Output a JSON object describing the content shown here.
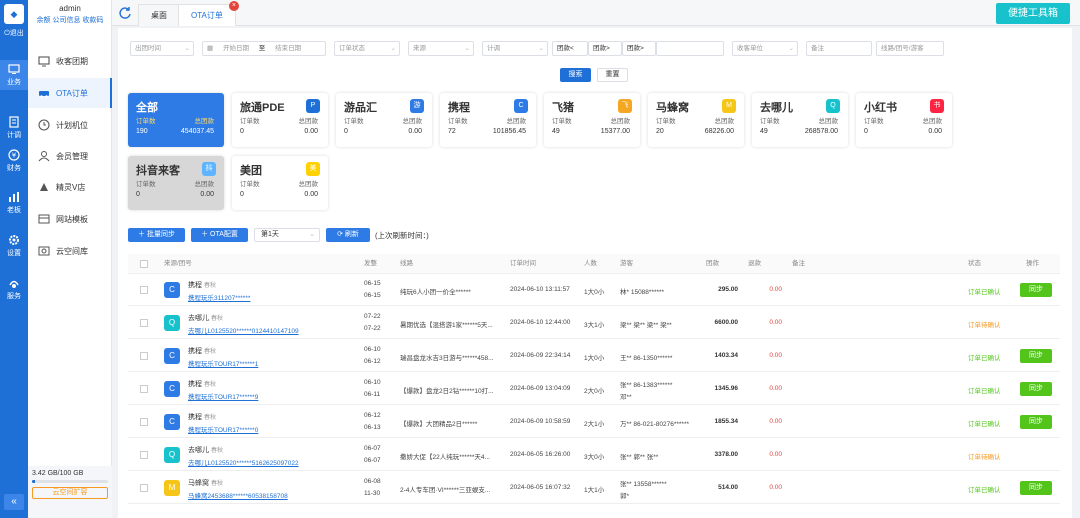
{
  "user": {
    "name": "admin",
    "links": "余额 公司信息 收款码"
  },
  "iconbar": {
    "logout": "退出",
    "items": [
      {
        "label": "业务",
        "icon": "business-icon",
        "active": true
      },
      {
        "label": "计调",
        "icon": "schedule-icon",
        "active": false
      },
      {
        "label": "财务",
        "icon": "finance-icon",
        "active": false
      },
      {
        "label": "老板",
        "icon": "chart-icon",
        "active": false
      },
      {
        "label": "设置",
        "icon": "gear-icon",
        "active": false
      },
      {
        "label": "服务",
        "icon": "service-icon",
        "active": false
      }
    ]
  },
  "menu": {
    "items": [
      {
        "label": "收客团期",
        "icon": "monitor-icon"
      },
      {
        "label": "OTA订单",
        "icon": "car-icon",
        "active": true
      },
      {
        "label": "计划机位",
        "icon": "clock-icon"
      },
      {
        "label": "会员管理",
        "icon": "member-icon"
      },
      {
        "label": "精灵V店",
        "icon": "store-icon"
      },
      {
        "label": "网站模板",
        "icon": "template-icon"
      },
      {
        "label": "云空间库",
        "icon": "cloud-icon"
      }
    ],
    "storage": {
      "text": "3.42 GB/100 GB",
      "used_fraction": 0.034,
      "expand": "云空间扩容"
    }
  },
  "tabs": [
    {
      "label": "桌面",
      "active": false
    },
    {
      "label": "OTA订单",
      "active": true
    }
  ],
  "toolbox": "便捷工具箱",
  "filters": {
    "time_type": "出团时间",
    "start_date": "开始日期",
    "to": "至",
    "end_date": "结束日期",
    "order_status": "订单状态",
    "source": "来源",
    "plan": "计调",
    "group_lt": "团款<",
    "group_gt": "团款>",
    "group_gt2": "团款>",
    "receiver": "收客单位",
    "remark": "备注",
    "line": "线路/团号/游客",
    "search": "搜索",
    "reset": "重置"
  },
  "cards": [
    {
      "title": "全部",
      "count_label": "订单数",
      "amount_label": "总团款",
      "count": "190",
      "amount": "454037.45",
      "logo": ""
    },
    {
      "title": "旅通PDE",
      "count_label": "订单数",
      "amount_label": "总团款",
      "count": "0",
      "amount": "0.00",
      "logo": "pde-logo-icon"
    },
    {
      "title": "游品汇",
      "count_label": "订单数",
      "amount_label": "总团款",
      "count": "0",
      "amount": "0.00",
      "logo": "youpinhui-logo-icon"
    },
    {
      "title": "携程",
      "count_label": "订单数",
      "amount_label": "总团款",
      "count": "72",
      "amount": "101856.45",
      "logo": "ctrip-logo-icon"
    },
    {
      "title": "飞猪",
      "count_label": "订单数",
      "amount_label": "总团款",
      "count": "49",
      "amount": "15377.00",
      "logo": "fliggy-logo-icon"
    },
    {
      "title": "马蜂窝",
      "count_label": "订单数",
      "amount_label": "总团款",
      "count": "20",
      "amount": "68226.00",
      "logo": "mafengwo-logo-icon"
    },
    {
      "title": "去哪儿",
      "count_label": "订单数",
      "amount_label": "总团款",
      "count": "49",
      "amount": "268578.00",
      "logo": "qunar-logo-icon"
    },
    {
      "title": "小红书",
      "count_label": "订单数",
      "amount_label": "总团款",
      "count": "0",
      "amount": "0.00",
      "logo": "xiaohongshu-logo-icon"
    },
    {
      "title": "抖音来客",
      "count_label": "订单数",
      "amount_label": "总团款",
      "count": "0",
      "amount": "0.00",
      "logo": "douyin-logo-icon"
    },
    {
      "title": "美团",
      "count_label": "订单数",
      "amount_label": "总团款",
      "count": "0",
      "amount": "0.00",
      "logo": "meituan-logo-icon"
    }
  ],
  "actions": {
    "batch_sync": "批量同步",
    "ota_config": "OTA配置",
    "days": "第1天",
    "refresh": "刷新",
    "last_refresh": "(上次刷新时间：)"
  },
  "table": {
    "headers": [
      "来源/团号",
      "发整",
      "线路",
      "订单时间",
      "人数",
      "游客",
      "团款",
      "退款",
      "备注",
      "状态",
      "操作"
    ],
    "rows": [
      {
        "source": "携程",
        "person": "春秋",
        "code": "携程玩乐311207******",
        "d1": "06-15",
        "d2": "06-15",
        "line": "纯玩6人小团一价全******",
        "time": "2024-06-10 13:11:57",
        "num": "1大0小",
        "guest": "林* 15088******",
        "guest2": "",
        "amount": "295.00",
        "refund": "0.00",
        "status": "订单已确认",
        "status_type": "ok",
        "sync": "同步"
      },
      {
        "source": "去哪儿",
        "person": "春秋",
        "code": "去哪儿L0125520******0124410147109",
        "d1": "07-22",
        "d2": "07-22",
        "line": "暑期优选【混搭游1家******5天...",
        "time": "2024-06-10 12:44:00",
        "num": "3大1小",
        "guest": "梁** 梁** 梁** 梁**",
        "guest2": "",
        "amount": "6600.00",
        "refund": "0.00",
        "status": "订单待确认",
        "status_type": "wait",
        "sync": ""
      },
      {
        "source": "携程",
        "person": "春秋",
        "code": "携程玩乐TOUR17******1",
        "d1": "06-10",
        "d2": "06-12",
        "line": "瑞昌盘龙水吉3日游与******458...",
        "time": "2024-06-09 22:34:14",
        "num": "1大0小",
        "guest": "王** 86-1350******",
        "guest2": "",
        "amount": "1403.34",
        "refund": "0.00",
        "status": "订单已确认",
        "status_type": "ok",
        "sync": "同步"
      },
      {
        "source": "携程",
        "person": "春秋",
        "code": "携程玩乐TOUR17******9",
        "d1": "06-10",
        "d2": "06-11",
        "line": "【爆款】盘龙2日2钻******10打...",
        "time": "2024-06-09 13:04:09",
        "num": "2大0小",
        "guest": "张** 86-1383******",
        "guest2": "邓**",
        "amount": "1345.96",
        "refund": "0.00",
        "status": "订单已确认",
        "status_type": "ok",
        "sync": "同步"
      },
      {
        "source": "携程",
        "person": "春秋",
        "code": "携程玩乐TOUR17******0",
        "d1": "06-12",
        "d2": "06-13",
        "line": "【爆款】大团精品2日******",
        "time": "2024-06-09 10:58:59",
        "num": "2大1小",
        "guest": "万** 86-021-80276******",
        "guest2": "",
        "amount": "1855.34",
        "refund": "0.00",
        "status": "订单已确认",
        "status_type": "ok",
        "sync": "同步"
      },
      {
        "source": "去哪儿",
        "person": "春秋",
        "code": "去哪儿L0125520******5162625097022",
        "d1": "06-07",
        "d2": "06-07",
        "line": "撒娇大促【22人纯玩******天4...",
        "time": "2024-06-05 16:26:00",
        "num": "3大0小",
        "guest": "张** 郭** 张**",
        "guest2": "",
        "amount": "3378.00",
        "refund": "0.00",
        "status": "订单待确认",
        "status_type": "wait",
        "sync": ""
      },
      {
        "source": "马蜂窝",
        "person": "春秋",
        "code": "马蜂窝2453688******60538158708",
        "d1": "06-08",
        "d2": "11-30",
        "line": "2-4人专车团·VI******三亚蜈支...",
        "time": "2024-06-05 16:07:32",
        "num": "1大1小",
        "guest": "张** 13558******",
        "guest2": "郭*",
        "amount": "514.00",
        "refund": "0.00",
        "status": "订单已确认",
        "status_type": "ok",
        "sync": "同步"
      }
    ]
  }
}
